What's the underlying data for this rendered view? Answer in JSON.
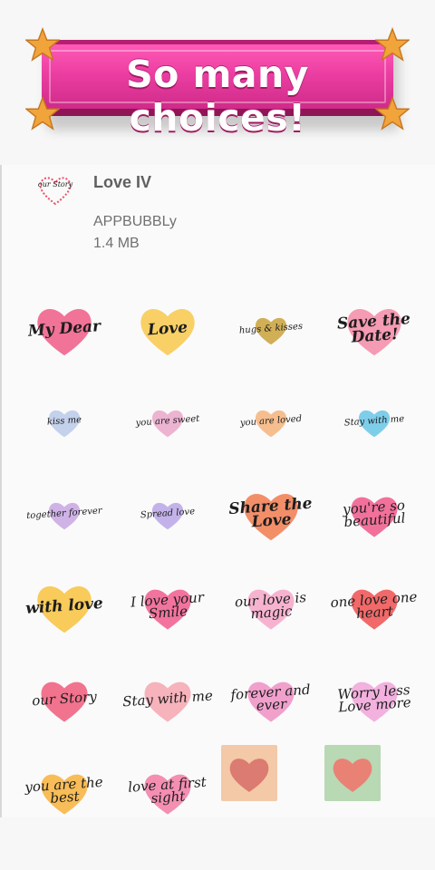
{
  "banner": {
    "text": "So many choices!"
  },
  "pack": {
    "icon_text": "our Story",
    "title": "Love IV",
    "author": "APPBUBBLy",
    "size": "1.4 MB"
  },
  "stickers": [
    {
      "text": "My Dear",
      "color": "#ef5a86",
      "size": "big"
    },
    {
      "text": "Love",
      "color": "#f7c84b",
      "size": "big"
    },
    {
      "text": "hugs & kisses",
      "color": "#c9a13a",
      "size": "small"
    },
    {
      "text": "Save the Date!",
      "color": "#f38aa6",
      "size": "big"
    },
    {
      "text": "kiss me",
      "color": "#b9c9e8",
      "size": "small"
    },
    {
      "text": "you are sweet",
      "color": "#e9a7c9",
      "size": "small"
    },
    {
      "text": "you are loved",
      "color": "#f4b37a",
      "size": "small"
    },
    {
      "text": "Stay with me",
      "color": "#67c6e6",
      "size": "small"
    },
    {
      "text": "together forever",
      "color": "#c7a6e3",
      "size": "small"
    },
    {
      "text": "Spread love",
      "color": "#b9a5e6",
      "size": "small"
    },
    {
      "text": "Share the Love",
      "color": "#f07b4f",
      "size": "big"
    },
    {
      "text": "you're so beautiful",
      "color": "#f0588a",
      "size": "mid"
    },
    {
      "text": "with love",
      "color": "#f7c23d",
      "size": "big"
    },
    {
      "text": "I love your Smile",
      "color": "#f05c8c",
      "size": "mid"
    },
    {
      "text": "our love is magic",
      "color": "#f4a6c8",
      "size": "mid"
    },
    {
      "text": "one love one heart",
      "color": "#ef4f4f",
      "size": "mid"
    },
    {
      "text": "our Story",
      "color": "#f05a7a",
      "size": "mid"
    },
    {
      "text": "Stay with me",
      "color": "#f5a6b0",
      "size": "mid"
    },
    {
      "text": "forever and ever",
      "color": "#ee8fc3",
      "size": "mid"
    },
    {
      "text": "Worry less Love more",
      "color": "#f0a3d8",
      "size": "mid"
    },
    {
      "text": "you are the best",
      "color": "#f7b23b",
      "size": "mid"
    },
    {
      "text": "love at first sight",
      "color": "#f27ba5",
      "size": "mid"
    },
    {
      "text": "",
      "color": "#d9726a",
      "size": "square",
      "bg": "#f3c9a8"
    },
    {
      "text": "",
      "color": "#f0786e",
      "size": "square",
      "bg": "#b9d8b4"
    }
  ]
}
